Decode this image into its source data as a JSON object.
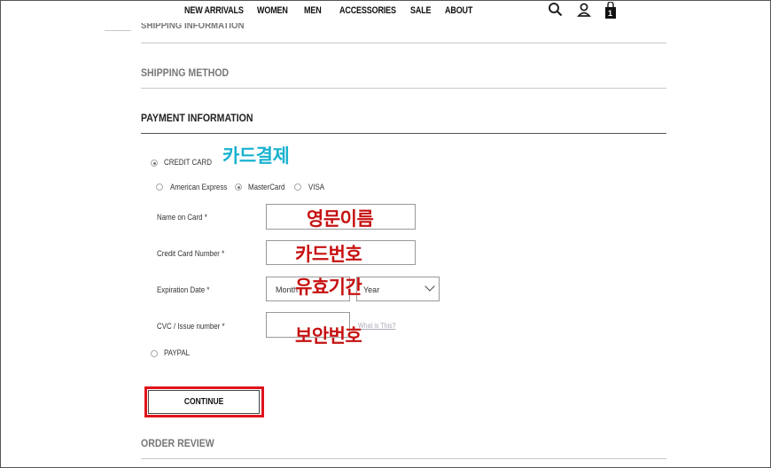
{
  "nav": {
    "links": [
      "NEW ARRIVALS",
      "WOMEN",
      "MEN",
      "ACCESSORIES",
      "SALE",
      "ABOUT"
    ],
    "cart_count": "1",
    "icons": [
      "search-icon",
      "user-icon",
      "cart-icon"
    ]
  },
  "sections": {
    "shipping_info_partial": "SHIPPING INFORMATION",
    "shipping_method": "SHIPPING METHOD",
    "payment_information": "PAYMENT INFORMATION",
    "order_review": "ORDER REVIEW"
  },
  "payment": {
    "credit_card_label": "CREDIT CARD",
    "card_types": [
      "American Express",
      "MasterCard",
      "VISA"
    ],
    "selected_card": "MasterCard",
    "name_on_card_label": "Name on Card *",
    "card_number_label": "Credit Card Number *",
    "expiration_label": "Expiration Date *",
    "month_placeholder": "Month",
    "year_placeholder": "Year",
    "cvc_label": "CVC / Issue number *",
    "whats_this": "What is This?",
    "paypal_label": "PAYPAL",
    "continue_label": "CONTINUE"
  },
  "annotations": {
    "card_payment": "카드결제",
    "english_name": "영문이름",
    "card_number": "카드번호",
    "expiry": "유효기간",
    "security_code": "보안번호"
  },
  "colors": {
    "annotation_red": "#c61111",
    "annotation_cyan": "#19b2cf",
    "highlight_border": "#e0141b"
  }
}
